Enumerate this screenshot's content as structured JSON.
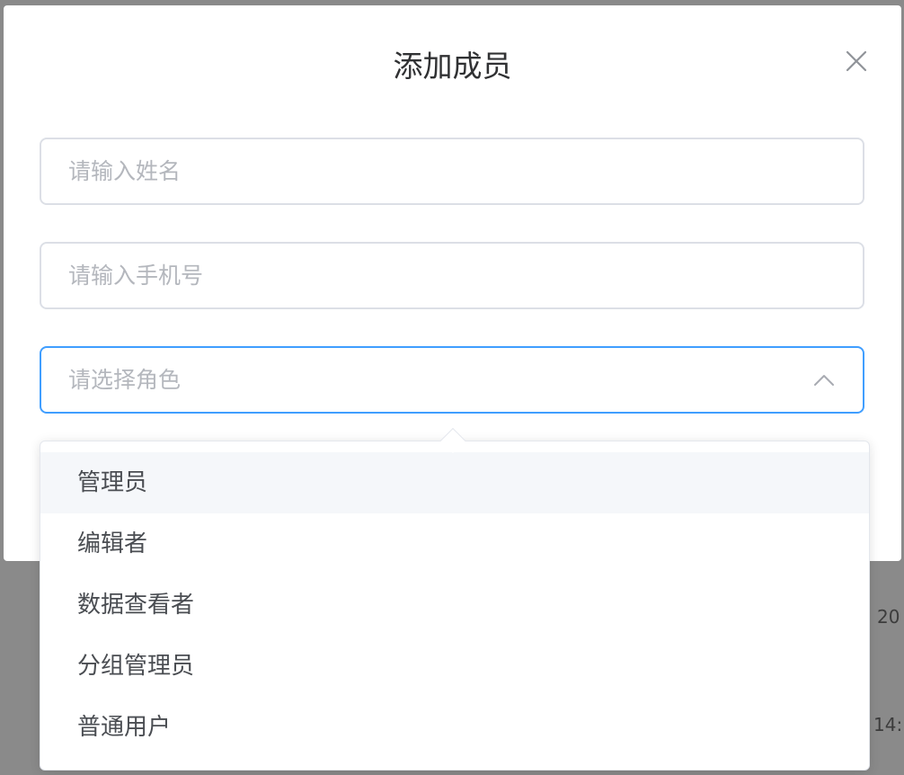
{
  "background": {
    "row_value_1": "20",
    "row_value_2": "14:"
  },
  "dialog": {
    "title": "添加成员",
    "close_icon": "close-icon",
    "name_input": {
      "placeholder": "请输入姓名",
      "value": ""
    },
    "phone_input": {
      "placeholder": "请输入手机号",
      "value": ""
    },
    "role_select": {
      "placeholder": "请选择角色",
      "icon": "chevron-up-icon",
      "open": true
    }
  },
  "role_dropdown": {
    "options": [
      {
        "label": "管理员",
        "hovered": true
      },
      {
        "label": "编辑者",
        "hovered": false
      },
      {
        "label": "数据查看者",
        "hovered": false
      },
      {
        "label": "分组管理员",
        "hovered": false
      },
      {
        "label": "普通用户",
        "hovered": false
      }
    ]
  },
  "colors": {
    "overlay": "#8a8a8a",
    "focus_border": "#409eff",
    "border": "#dcdfe6",
    "placeholder": "#b4b7bd",
    "hover_bg": "#f5f7fa"
  }
}
